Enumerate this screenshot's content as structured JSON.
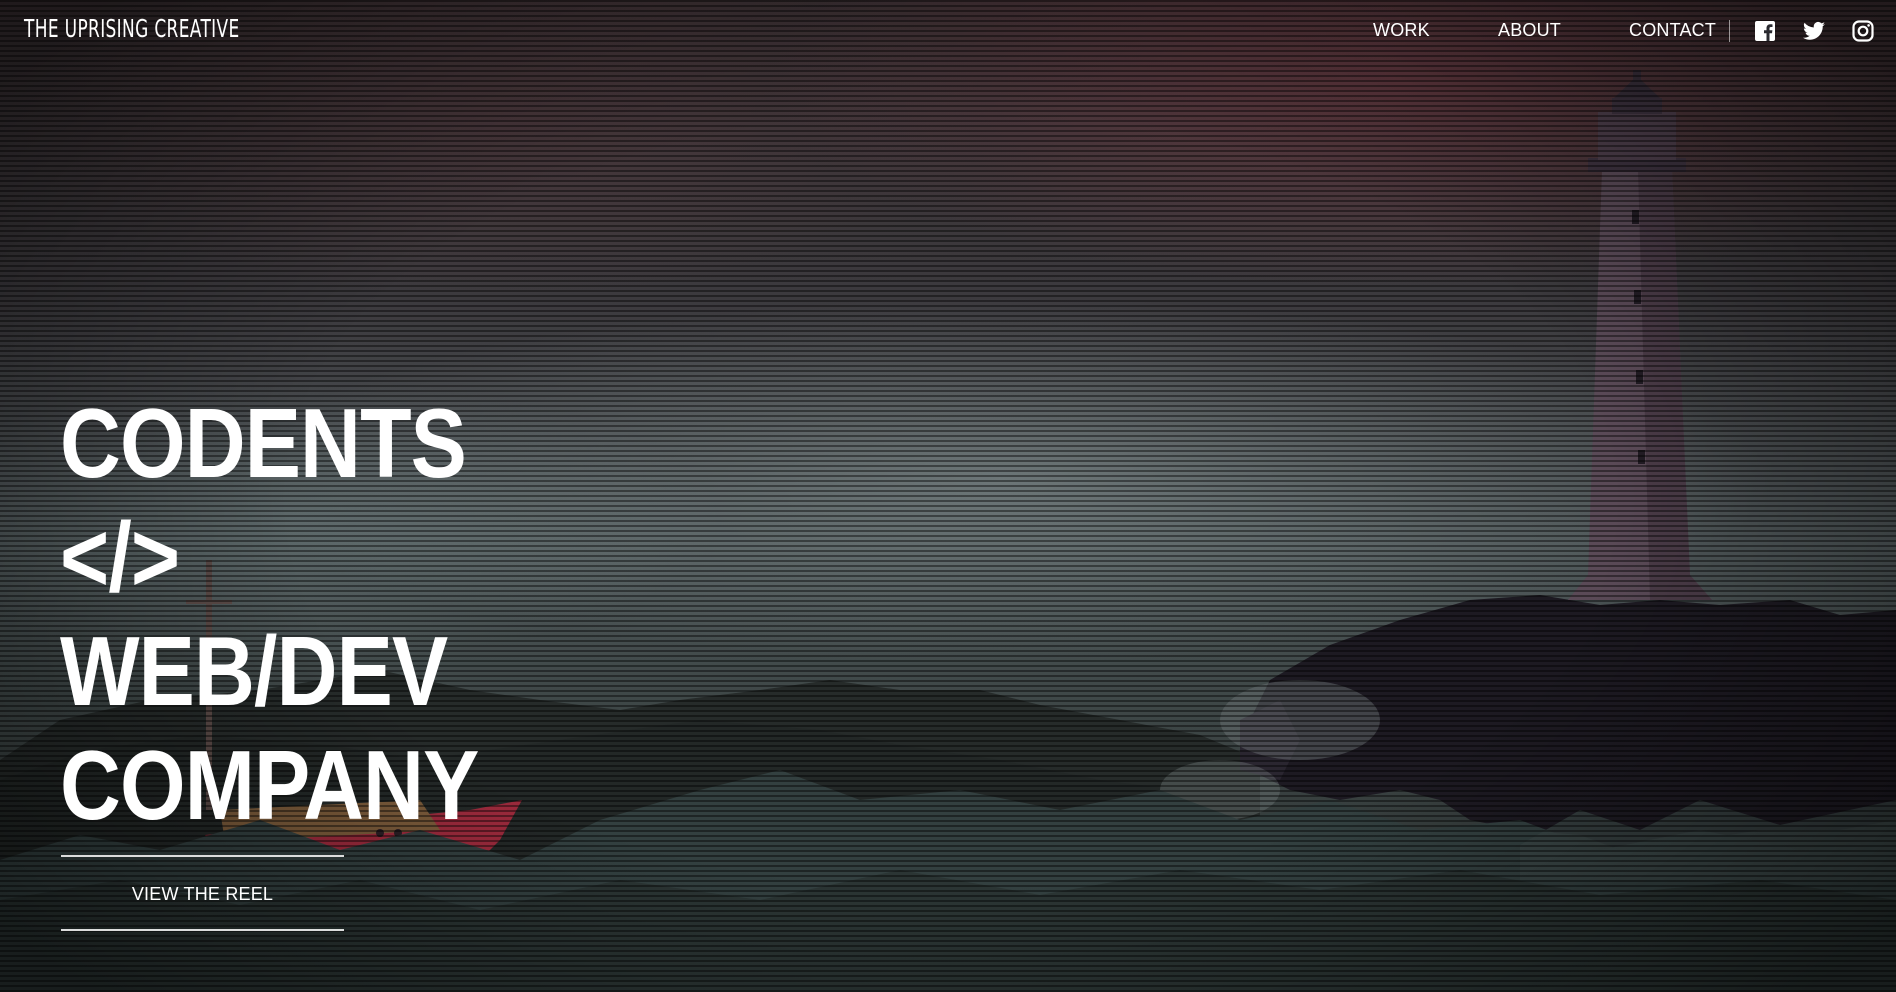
{
  "header": {
    "brand": "THE UPRISING CREATIVE",
    "nav": [
      "WORK",
      "ABOUT",
      "CONTACT"
    ],
    "social_icons": [
      "facebook-icon",
      "twitter-icon",
      "instagram-icon"
    ]
  },
  "hero": {
    "lines": [
      "CODENTS",
      "</>",
      "WEB/DEV",
      "COMPANY"
    ],
    "cta_label": "VIEW THE REEL"
  },
  "colors": {
    "text": "#ffffff",
    "background": "#1c1d22",
    "boat_hull": "#9b2a3c"
  }
}
